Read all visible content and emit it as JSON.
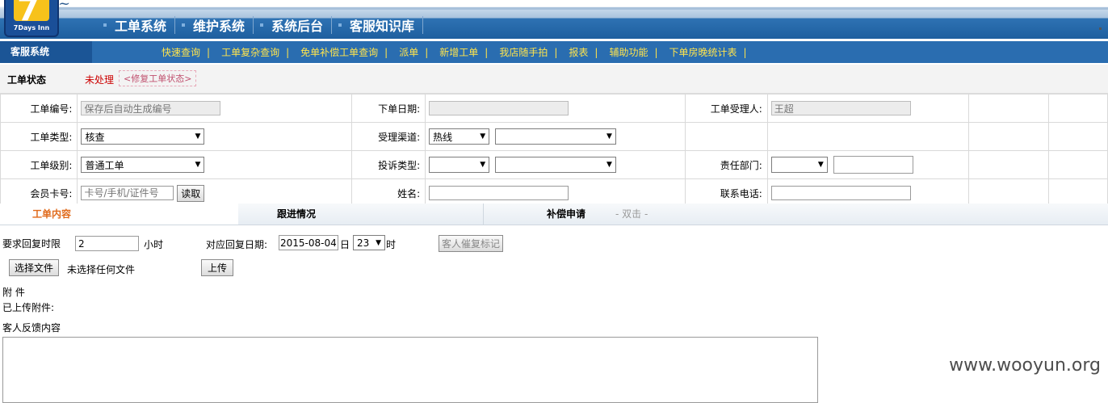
{
  "header": {
    "logo_text": "7Days Inn",
    "logo_numeral": "7",
    "nav": [
      "工单系统",
      "维护系统",
      "系统后台",
      "客服知识库"
    ]
  },
  "subnav": {
    "system_label": "客服系统",
    "links": [
      "快速查询",
      "工单复杂查询",
      "免单补偿工单查询",
      "派单",
      "新增工单",
      "我店随手拍",
      "报表",
      "辅助功能",
      "下单房晚统计表"
    ]
  },
  "status": {
    "label": "工单状态",
    "value": "未处理",
    "fix_link": "<修复工单状态>"
  },
  "form": {
    "ticket_no_label": "工单编号:",
    "ticket_no_value": "保存后自动生成编号",
    "order_date_label": "下单日期:",
    "order_date_value": "",
    "handler_label": "工单受理人:",
    "handler_value": "王超",
    "ticket_type_label": "工单类型:",
    "ticket_type_value": "核查",
    "channel_label": "受理渠道:",
    "channel_value": "热线",
    "channel_sub_value": "",
    "ticket_level_label": "工单级别:",
    "ticket_level_value": "普通工单",
    "complaint_type_label": "投诉类型:",
    "complaint_type_value": "",
    "complaint_sub_value": "",
    "dept_label": "责任部门:",
    "dept_value": "",
    "dept_input_value": "",
    "member_label": "会员卡号:",
    "member_placeholder": "卡号/手机/证件号",
    "read_button": "读取",
    "name_label": "姓名:",
    "name_value": "",
    "phone_label": "联系电话:",
    "phone_value": ""
  },
  "tabs": {
    "content": "工单内容",
    "followup": "跟进情况",
    "compensation": "补偿申请",
    "double_click_hint": "- 双击 -"
  },
  "content": {
    "reply_limit_label": "要求回复时限",
    "reply_limit_value": "2",
    "hours_unit": "小时",
    "reply_date_label": "对应回复日期:",
    "reply_date_value": "2015-08-04",
    "day_unit": "日",
    "hour_value": "23",
    "hour_unit": "时",
    "remind_button": "客人催复标记",
    "choose_file_button": "选择文件",
    "no_file_text": "未选择任何文件",
    "upload_button": "上传",
    "attachment_label": "附 件",
    "uploaded_label": "已上传附件:",
    "feedback_label": "客人反馈内容",
    "feedback_value": ""
  },
  "watermark": "www.wooyun.org"
}
